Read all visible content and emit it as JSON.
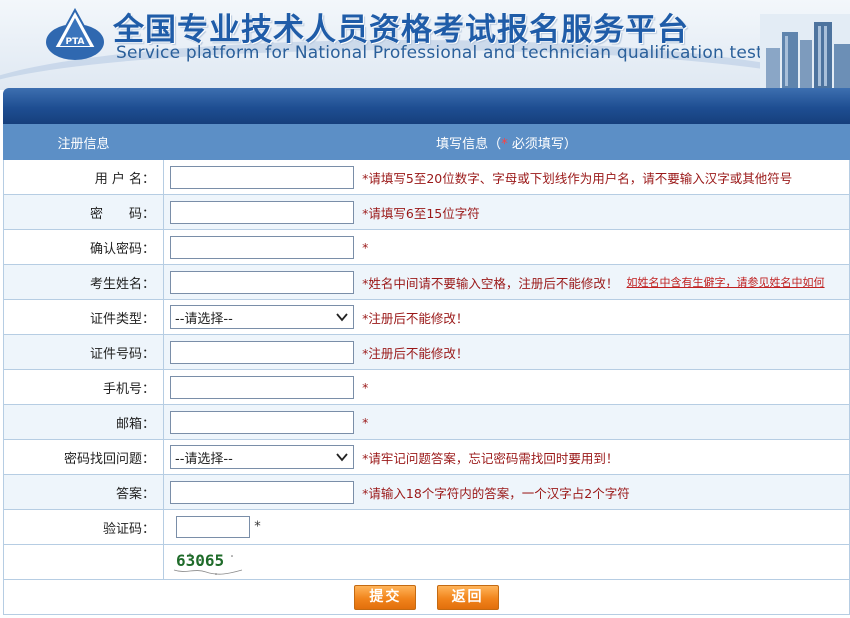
{
  "header": {
    "logo_text": "PTA",
    "title_cn": "全国专业技术人员资格考试报名服务平台",
    "title_en": "Service platform for National Professional and technician  qualification test"
  },
  "table_head": {
    "left": "注册信息",
    "right_prefix": "填写信息（",
    "right_star": "*",
    "right_suffix": " 必须填写）"
  },
  "fields": {
    "username": {
      "label": "用 户 名：",
      "value": "",
      "hint": "*请填写5至20位数字、字母或下划线作为用户名，请不要输入汉字或其他符号"
    },
    "password": {
      "label": "密　　码：",
      "value": "",
      "hint": "*请填写6至15位字符"
    },
    "confirm_password": {
      "label": "确认密码：",
      "value": "",
      "hint": "*"
    },
    "name": {
      "label": "考生姓名：",
      "value": "",
      "hint": "*姓名中间请不要输入空格，注册后不能修改！",
      "link": "如姓名中含有生僻字，请参见姓名中如何"
    },
    "id_type": {
      "label": "证件类型：",
      "selected": "--请选择--",
      "hint": "*注册后不能修改！"
    },
    "id_number": {
      "label": "证件号码：",
      "value": "",
      "hint": "*注册后不能修改！"
    },
    "phone": {
      "label": "手机号：",
      "value": "",
      "hint": "*"
    },
    "email": {
      "label": "邮箱：",
      "value": "",
      "hint": "*"
    },
    "security_question": {
      "label": "密码找回问题：",
      "selected": "--请选择--",
      "hint": "*请牢记问题答案，忘记密码需找回时要用到！"
    },
    "answer": {
      "label": "答案：",
      "value": "",
      "hint": "*请输入18个字符内的答案，一个汉字占2个字符"
    },
    "captcha": {
      "label": "验证码：",
      "value": "",
      "star": "*",
      "image_text": "63065"
    }
  },
  "buttons": {
    "submit": "提交",
    "back": "返回"
  },
  "colors": {
    "header_blue": "#1f5ca8",
    "bar_blue": "#1e4e92",
    "table_head": "#5c8fc6",
    "row_alt": "#eef5fb",
    "hint_red": "#9a1818",
    "button_orange": "#f1841c"
  },
  "icons": {
    "logo": "pta-triangle-logo",
    "select_arrow": "chevron-down-icon"
  }
}
